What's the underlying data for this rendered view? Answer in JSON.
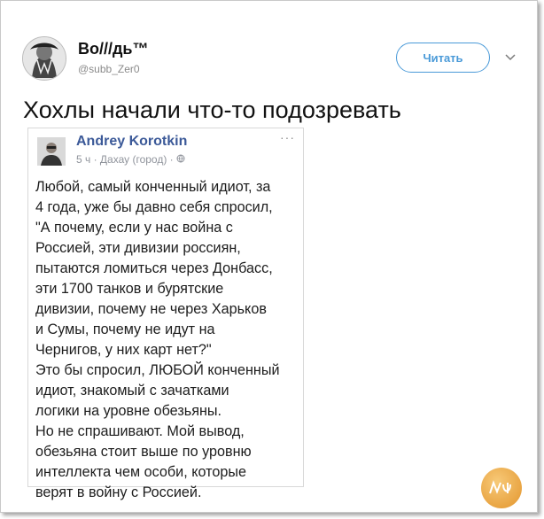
{
  "tweet": {
    "display_name": "Во///дь™",
    "handle": "@subb_Zer0",
    "follow_label": "Читать",
    "text": "Хохлы начали что-то подозревать"
  },
  "embedded_post": {
    "author": "Andrey Korotkin",
    "meta": "5 ч · Дахау (город) · ",
    "menu": "···",
    "lines": [
      "Любой, самый конченный идиот, за",
      "4 года, уже бы давно себя спросил,",
      "\"А почему, если у нас война с",
      "Россией, эти дивизии россиян,",
      "пытаются ломиться через Донбасс,",
      "эти 1700 танков и бурятские",
      "дивизии, почему не через Харьков",
      "и Сумы,  почему не идут на",
      "Чернигов, у них карт нет?\"",
      "Это бы спросил, ЛЮБОЙ конченный",
      "идиот,  знакомый с зачатками",
      "логики на уровне обезьяны.",
      "Но не спрашивают. Мой вывод,",
      "обезьяна стоит выше по уровню",
      "интеллекта чем особи,  которые",
      "верят в войну с Россией."
    ]
  },
  "icons": {
    "globe": "globe-icon",
    "chevron": "chevron-down-icon"
  },
  "colors": {
    "follow_blue": "#4a9ad8",
    "facebook_link": "#3b5998"
  }
}
